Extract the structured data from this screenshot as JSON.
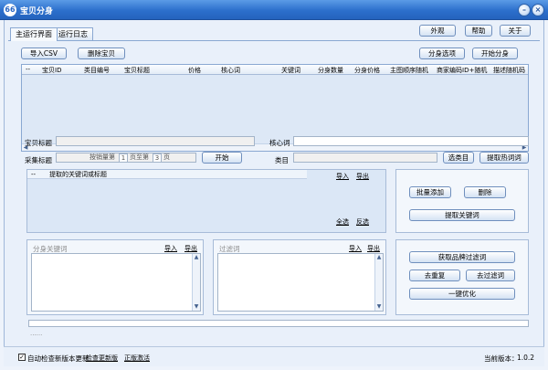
{
  "window": {
    "title": "宝贝分身",
    "icon_text": "66",
    "controls": [
      "minimize",
      "close"
    ]
  },
  "tabs": [
    {
      "label": "主运行界面",
      "active": true
    },
    {
      "label": "运行日志",
      "active": false
    }
  ],
  "top_right_buttons": {
    "skin": "外观",
    "help": "帮助",
    "about": "关于"
  },
  "toolbar": {
    "import_csv": "导入CSV",
    "delete_item": "删除宝贝",
    "clone_options": "分身选项",
    "start_clone": "开始分身"
  },
  "grid": {
    "columns": [
      "--",
      "宝贝ID",
      "类目编号",
      "宝贝标题",
      "价格",
      "核心词",
      "关键词",
      "分身数量",
      "分身价格",
      "主图顺序随机",
      "商家编码ID+随机",
      "描述随机码"
    ]
  },
  "form": {
    "title_label": "宝贝标题",
    "core_word_label": "核心词",
    "collect_title_label": "采集标题",
    "range_text_prefix": "按销量第",
    "range_from": "1",
    "range_mid": "页至第",
    "range_to": "3",
    "range_suffix": "页",
    "start_button": "开始",
    "category_label": "类目",
    "select_category": "选类目",
    "extract_hot_words": "提取热词词"
  },
  "keywords_panel": {
    "col_dash": "--",
    "col_title": "提取的关键词或标题",
    "import": "导入",
    "export": "导出",
    "select_all": "全选",
    "invert": "反选"
  },
  "keyword_actions": {
    "batch_add": "批量添加",
    "delete": "删除",
    "extract_keywords": "提取关键词"
  },
  "split_keywords": {
    "title": "分身关键词",
    "import": "导入",
    "export": "导出"
  },
  "filter_words": {
    "title": "过滤词",
    "import": "导入",
    "export": "导出"
  },
  "filter_actions": {
    "get_brand_filter": "获取品牌过滤词",
    "dedupe": "去重复",
    "remove_filter": "去过滤词",
    "optimize": "一键优化"
  },
  "status_dots": "......",
  "statusbar": {
    "auto_check_label": "自动检查新版本更新",
    "auto_check_checked": true,
    "check_update": "检查更新版",
    "activate": "正版激活",
    "version_label": "当前版本：",
    "version": "1.0.2"
  },
  "colors": {
    "titlebar": "#2c6fcc",
    "panel_bg": "#dbe7f6",
    "window_bg": "#e9f0fa"
  }
}
